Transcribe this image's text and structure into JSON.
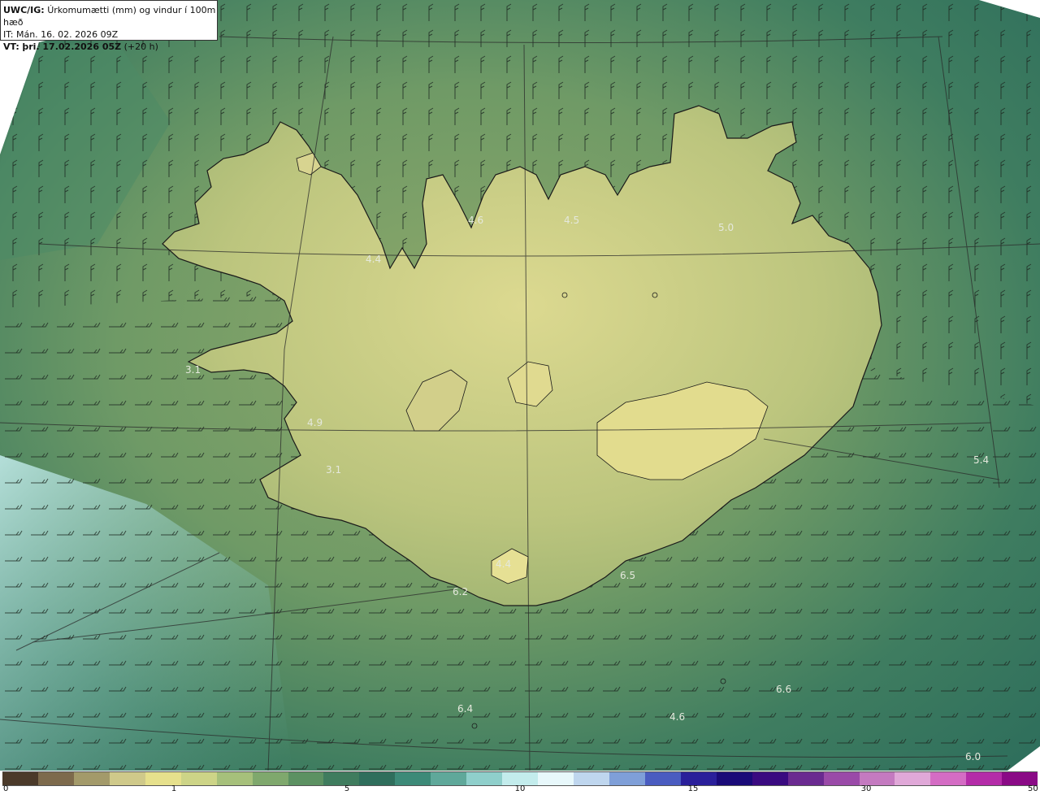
{
  "header": {
    "product": "UWC/IG:",
    "title": "Úrkomumætti (mm) og vindur í 100m hæð",
    "issue_time": "IT: Mán. 16. 02. 2026 09Z",
    "valid_prefix": "VT:",
    "valid_time": "þri. 17.02.2026 05Z",
    "lead_time": "(+20 h)"
  },
  "map_values": [
    "4.6",
    "4.5",
    "5.0",
    "4.4",
    "3.1",
    "4.9",
    "3.1",
    "4.4",
    "6.2",
    "6.5",
    "5.4",
    "6.6",
    "6.4",
    "4.6",
    "6.0"
  ],
  "legend": {
    "ticks": [
      "0",
      "1",
      "5",
      "10",
      "15",
      "30",
      "50"
    ],
    "colors": [
      "#4b3a2a",
      "#7d6a4c",
      "#a39a6a",
      "#cfc98a",
      "#e6e08c",
      "#cdd487",
      "#a6c07b",
      "#7fa86d",
      "#5c9162",
      "#3f7c5e",
      "#2f6e5c",
      "#3d8a78",
      "#5fa89a",
      "#8fcfcb",
      "#c3ecec",
      "#e8f8fb",
      "#bfd6ee",
      "#7f9fd8",
      "#4a5cc0",
      "#2a1f9a",
      "#1a0a78",
      "#3a0a80",
      "#6a2a90",
      "#9a4aa8",
      "#c47ac0",
      "#e0a8d8",
      "#d46cc4",
      "#b42ca8",
      "#8a0a86"
    ]
  }
}
